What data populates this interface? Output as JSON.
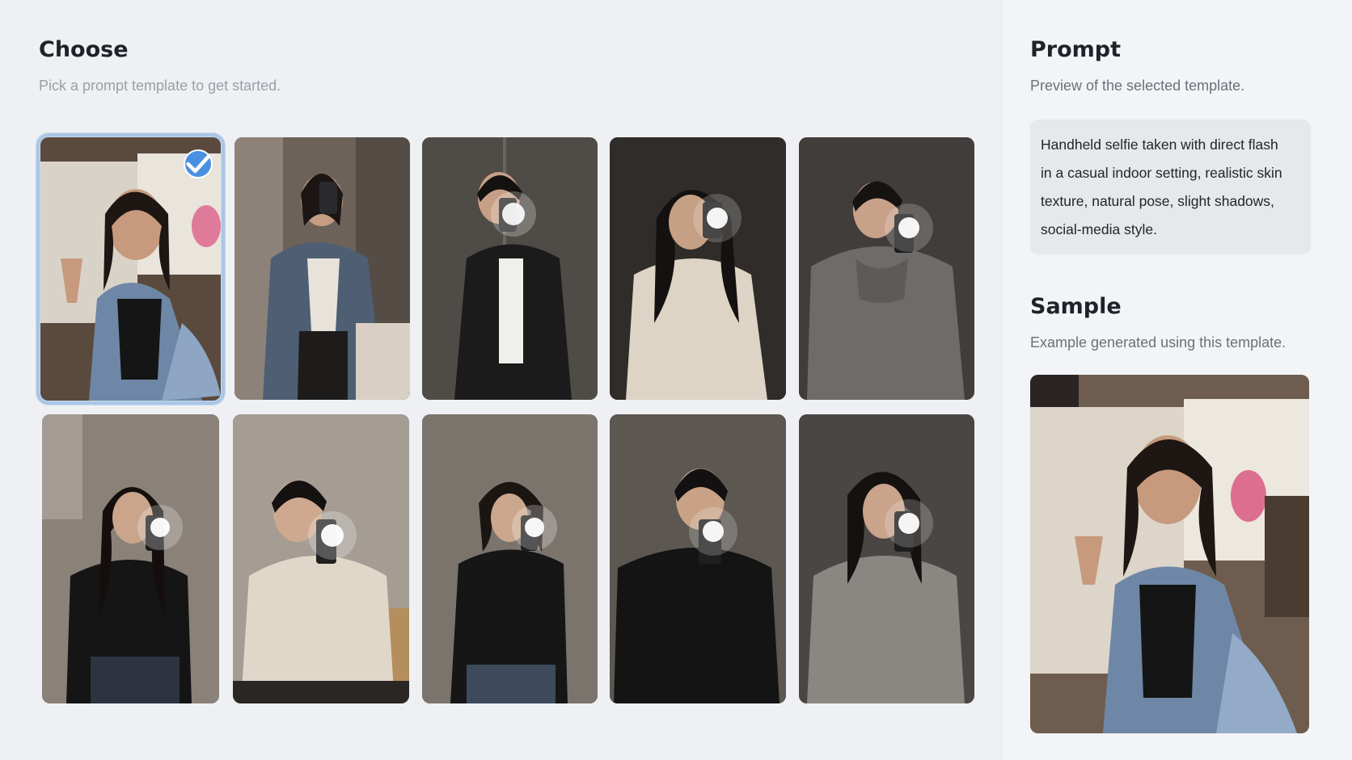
{
  "choose": {
    "title": "Choose",
    "subtitle": "Pick a prompt template to get started."
  },
  "templates": [
    {
      "selected": true,
      "subject": "woman-denim-jacket-peace-sign",
      "tone": "#5a4a3e"
    },
    {
      "selected": false,
      "subject": "woman-denim-jacket-mirror",
      "tone": "#6d6259"
    },
    {
      "selected": false,
      "subject": "man-leather-jacket-mirror-flash",
      "tone": "#4f4b46"
    },
    {
      "selected": false,
      "subject": "woman-cream-sweater-mirror-flash",
      "tone": "#2f2c29"
    },
    {
      "selected": false,
      "subject": "man-grey-hoodie-mirror-flash",
      "tone": "#403d3a"
    },
    {
      "selected": false,
      "subject": "woman-black-top-mirror-flash",
      "tone": "#8a8179"
    },
    {
      "selected": false,
      "subject": "man-beige-sweater-mirror-flash",
      "tone": "#a59d94"
    },
    {
      "selected": false,
      "subject": "woman-black-top-mirror-flash-2",
      "tone": "#7b746d"
    },
    {
      "selected": false,
      "subject": "man-black-sweater-mirror-flash",
      "tone": "#5c5751"
    },
    {
      "selected": false,
      "subject": "woman-grey-sweater-mirror-flash",
      "tone": "#4a4643"
    }
  ],
  "prompt": {
    "title": "Prompt",
    "subtitle": "Preview of the selected template.",
    "lines": [
      "Handheld selfie taken with direct flash",
      "in a casual indoor setting, realistic skin",
      "texture, natural pose, slight shadows,",
      "social-media style."
    ]
  },
  "sample": {
    "title": "Sample",
    "subtitle": "Example generated using this template."
  },
  "colors": {
    "accent": "#4a90e2",
    "selected_outline": "#a9c6e6"
  },
  "icons": {
    "selected_marker": "checkmark-icon"
  }
}
